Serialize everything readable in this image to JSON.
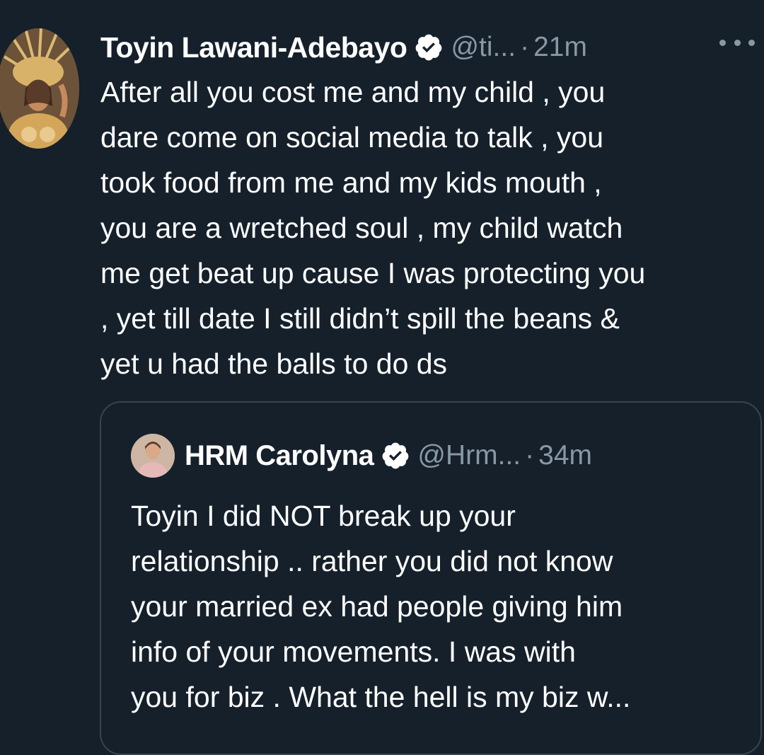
{
  "tweet": {
    "author_name": "Toyin Lawani-Adebayo",
    "handle": "@ti...",
    "separator": "·",
    "time": "21m",
    "text": "After all you cost me and my child , you\ndare come on social media to talk , you\ntook food from me and my kids mouth ,\nyou are a wretched soul , my child watch\nme get beat up cause I was protecting you\n, yet till date I still didn’t spill the beans &\nyet u had the balls to do ds"
  },
  "quoted_tweet": {
    "author_name": "HRM Carolyna",
    "handle": "@Hrm...",
    "separator": "·",
    "time": "34m",
    "text": "Toyin I did NOT break up your\nrelationship .. rather you did not know\nyour married ex had people giving him\ninfo of your movements. I was with\nyou for biz . What the hell is my biz w..."
  },
  "colors": {
    "background": "#15202b",
    "text_primary": "#ffffff",
    "text_secondary": "#8899a6",
    "border": "#38444d"
  },
  "icons": {
    "verified": "verified-badge-icon",
    "more": "more-horizontal-icon"
  }
}
